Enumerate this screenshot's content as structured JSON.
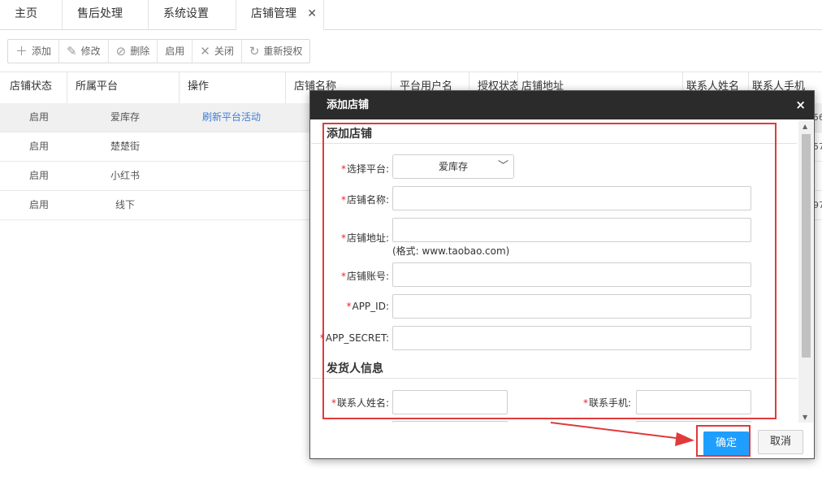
{
  "tabs": [
    {
      "label": "主页"
    },
    {
      "label": "售后处理"
    },
    {
      "label": "系统设置"
    },
    {
      "label": "店铺管理",
      "close": "✕"
    }
  ],
  "toolbar": {
    "add": "添加",
    "edit": "修改",
    "delete": "删除",
    "enable": "启用",
    "close": "关闭",
    "reauth": "重新授权"
  },
  "table": {
    "columns": [
      "店铺状态",
      "所属平台",
      "操作",
      "店铺名称",
      "平台用户名",
      "授权状态",
      "店铺地址",
      "联系人姓名",
      "联系人手机"
    ],
    "rows": [
      {
        "status": "启用",
        "platform": "爱库存",
        "action": "刷新平台活动",
        "edge": "56"
      },
      {
        "status": "启用",
        "platform": "楚楚街",
        "action": "",
        "edge": "57"
      },
      {
        "status": "启用",
        "platform": "小红书",
        "action": "",
        "edge": ""
      },
      {
        "status": "启用",
        "platform": "线下",
        "action": "",
        "edge": "97"
      }
    ]
  },
  "modal": {
    "title": "添加店铺",
    "close": "×",
    "section_store": "添加店铺",
    "section_sender": "发货人信息",
    "required_mark": "*",
    "fields": {
      "platform": {
        "label": "选择平台:",
        "value": "爱库存"
      },
      "store_name": {
        "label": "店铺名称:",
        "value": ""
      },
      "store_url": {
        "label": "店铺地址:",
        "value": "",
        "hint": "(格式: www.taobao.com)"
      },
      "store_account": {
        "label": "店铺账号:",
        "value": ""
      },
      "app_id": {
        "label": "APP_ID:",
        "value": ""
      },
      "app_secret": {
        "label": "APP_SECRET:",
        "value": ""
      },
      "contact_name": {
        "label": "联系人姓名:",
        "value": ""
      },
      "contact_phone": {
        "label": "联系手机:",
        "value": ""
      }
    },
    "ok": "确定",
    "cancel": "取消"
  },
  "colors": {
    "accent": "#1e9fff",
    "annotation": "#e03a3a",
    "header": "#2b2b2b"
  }
}
